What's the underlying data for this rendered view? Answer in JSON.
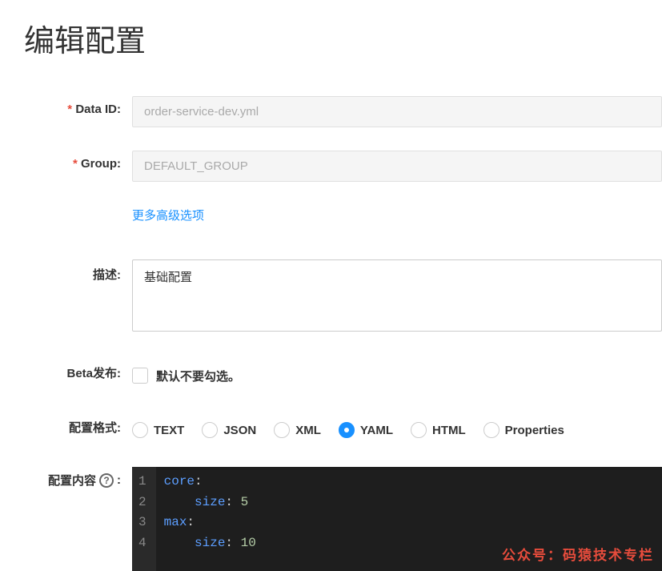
{
  "page": {
    "title": "编辑配置"
  },
  "form": {
    "dataId": {
      "label": "Data ID:",
      "value": "order-service-dev.yml"
    },
    "group": {
      "label": "Group:",
      "value": "DEFAULT_GROUP"
    },
    "advancedOptions": "更多高级选项",
    "description": {
      "label": "描述:",
      "value": "基础配置"
    },
    "beta": {
      "label": "Beta发布:",
      "text": "默认不要勾选。",
      "checked": false
    },
    "format": {
      "label": "配置格式:",
      "options": [
        "TEXT",
        "JSON",
        "XML",
        "YAML",
        "HTML",
        "Properties"
      ],
      "selected": "YAML"
    },
    "content": {
      "label": "配置内容",
      "helpSuffix": ":",
      "lines": [
        {
          "indent": 0,
          "key": "core",
          "colon": ":",
          "value": ""
        },
        {
          "indent": 1,
          "key": "size",
          "colon": ": ",
          "value": "5"
        },
        {
          "indent": 0,
          "key": "max",
          "colon": ":",
          "value": ""
        },
        {
          "indent": 1,
          "key": "size",
          "colon": ": ",
          "value": "10"
        }
      ]
    }
  },
  "watermark": "公众号：码猿技术专栏"
}
